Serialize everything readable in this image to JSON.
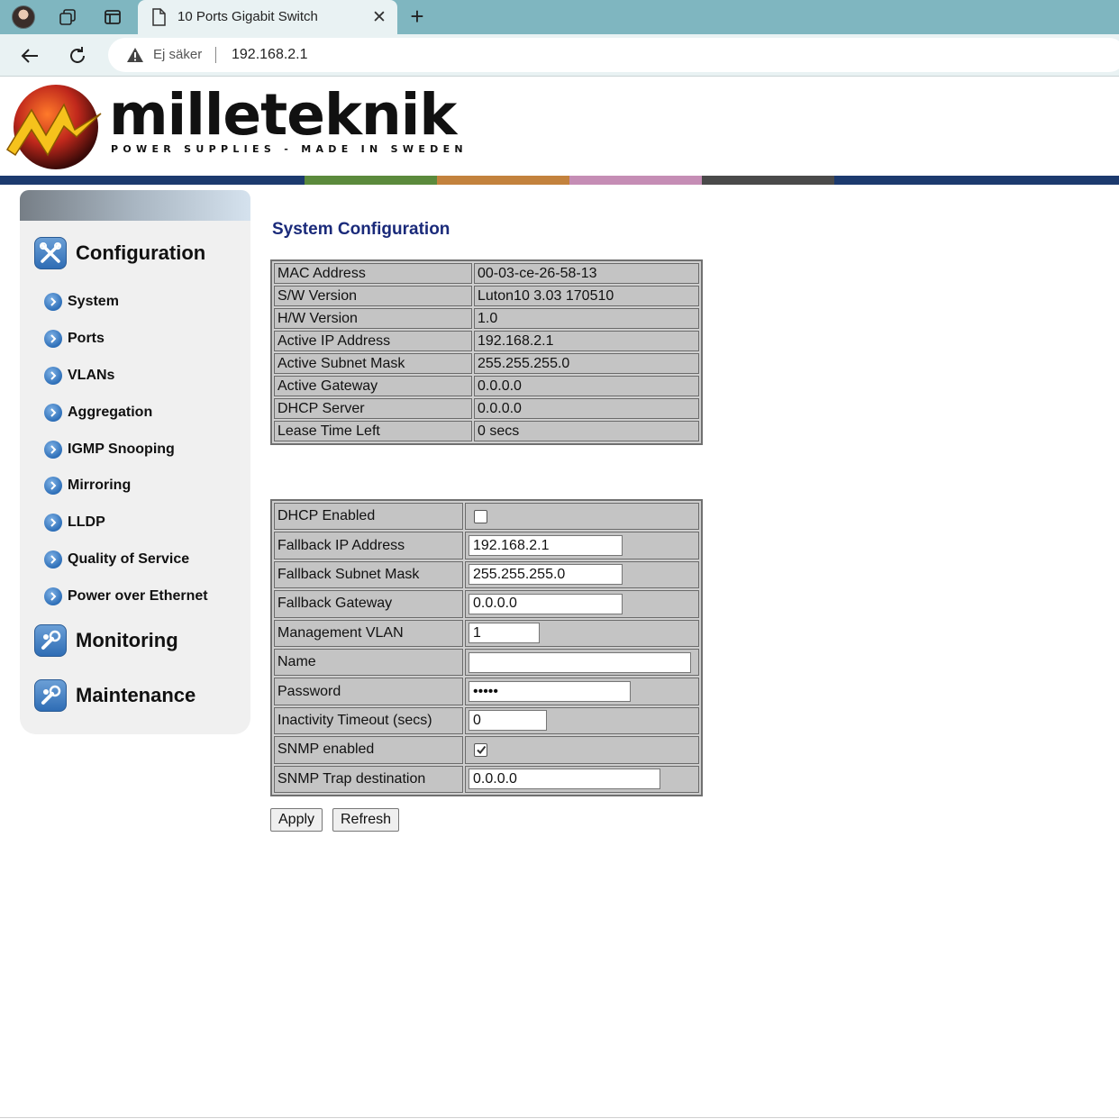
{
  "browser": {
    "tab_title": "10 Ports Gigabit Switch",
    "security_label": "Ej säker",
    "url": "192.168.2.1"
  },
  "header": {
    "brand_name": "milleteknik",
    "brand_tagline": "POWER SUPPLIES - MADE IN SWEDEN",
    "stripe_colors": [
      "#1c3a6e",
      "#5b8a3c",
      "#c3823d",
      "#c58db5",
      "#4a4a4a",
      "#1c3a6e"
    ]
  },
  "sidebar": {
    "sections": [
      {
        "label": "Configuration",
        "icon": "tools-icon"
      },
      {
        "label": "Monitoring",
        "icon": "monitor-tools-icon"
      },
      {
        "label": "Maintenance",
        "icon": "maintenance-tools-icon"
      }
    ],
    "items": [
      {
        "label": "System"
      },
      {
        "label": "Ports"
      },
      {
        "label": "VLANs"
      },
      {
        "label": "Aggregation"
      },
      {
        "label": "IGMP Snooping"
      },
      {
        "label": "Mirroring"
      },
      {
        "label": "LLDP"
      },
      {
        "label": "Quality of Service"
      },
      {
        "label": "Power over Ethernet"
      }
    ]
  },
  "main": {
    "title": "System Configuration",
    "info_rows": [
      {
        "label": "MAC Address",
        "value": "00-03-ce-26-58-13"
      },
      {
        "label": "S/W Version",
        "value": "Luton10 3.03 170510"
      },
      {
        "label": "H/W Version",
        "value": "1.0"
      },
      {
        "label": "Active IP Address",
        "value": "192.168.2.1"
      },
      {
        "label": "Active Subnet Mask",
        "value": "255.255.255.0"
      },
      {
        "label": "Active Gateway",
        "value": "0.0.0.0"
      },
      {
        "label": "DHCP Server",
        "value": "0.0.0.0"
      },
      {
        "label": "Lease Time Left",
        "value": "0 secs"
      }
    ],
    "form": {
      "dhcp_enabled": {
        "label": "DHCP Enabled",
        "checked": false
      },
      "fallback_ip": {
        "label": "Fallback IP Address",
        "value": "192.168.2.1"
      },
      "fallback_mask": {
        "label": "Fallback Subnet Mask",
        "value": "255.255.255.0"
      },
      "fallback_gateway": {
        "label": "Fallback Gateway",
        "value": "0.0.0.0"
      },
      "management_vlan": {
        "label": "Management VLAN",
        "value": "1"
      },
      "name": {
        "label": "Name",
        "value": ""
      },
      "password": {
        "label": "Password",
        "value": "•••••"
      },
      "inactivity_timeout": {
        "label": "Inactivity Timeout (secs)",
        "value": "0"
      },
      "snmp_enabled": {
        "label": "SNMP enabled",
        "checked": true
      },
      "snmp_trap": {
        "label": "SNMP Trap destination",
        "value": "0.0.0.0"
      }
    },
    "apply_label": "Apply",
    "refresh_label": "Refresh"
  }
}
